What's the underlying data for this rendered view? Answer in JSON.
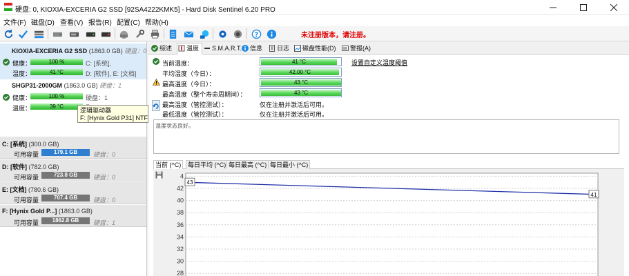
{
  "window": {
    "title": "硬盘: 0, KIOXIA-EXCERIA G2 SSD [92SA4222KMK5] - Hard Disk Sentinel 6.20 PRO"
  },
  "menu": [
    "文件(F)",
    "磁盘(D)",
    "查看(V)",
    "报告(R)",
    "配置(C)",
    "帮助(H)"
  ],
  "toolbar": {
    "unregistered": "未注册版本，请注册。"
  },
  "disks": [
    {
      "name": "KIOXIA-EXCERIA G2 SSD",
      "size": "(1863.0 GB)",
      "disk_label": "硬盘：0",
      "health_label": "健康：",
      "health_value": "100 %",
      "health_percent": 100,
      "temp_label": "温度：",
      "temp_value": "41 °C",
      "partitions_a": "C: [系统],",
      "partitions_b": "D: [软件], E: [文档]"
    },
    {
      "name": "SHGP31-2000GM",
      "size": "(1863.0 GB)",
      "disk_label": "硬盘：1",
      "health_label": "健康：",
      "health_value": "100 %",
      "health_percent": 100,
      "temp_label": "温度：",
      "temp_value": "39 °C",
      "partitions_a": "F:"
    }
  ],
  "tooltip": {
    "line1": "逻辑驱动器",
    "line2": "F: [Hynix Gold P31] NTFS"
  },
  "volumes": [
    {
      "name": "C: [系统]",
      "size": "(300.0 GB)",
      "free_label": "可用容量",
      "free_value": "179.1 GB",
      "disk": "硬盘：0",
      "color": "#2f7fd0"
    },
    {
      "name": "D: [软件]",
      "size": "(782.0 GB)",
      "free_label": "可用容量",
      "free_value": "723.8 GB",
      "disk": "硬盘：0",
      "color": "#767676"
    },
    {
      "name": "E: [文档]",
      "size": "(780.6 GB)",
      "free_label": "可用容量",
      "free_value": "707.4 GB",
      "disk": "硬盘：0",
      "color": "#767676"
    },
    {
      "name": "F: [Hynix Gold P...]",
      "size": "(1863.0 GB)",
      "free_label": "可用容量",
      "free_value": "1862.8 GB",
      "disk": "硬盘：1",
      "color": "#767676"
    }
  ],
  "tabs": [
    "综述",
    "温度",
    "S.M.A.R.T.",
    "信息",
    "日志",
    "磁盘性能(D)",
    "警报(A)"
  ],
  "temperature": {
    "rows": [
      {
        "label": "当前温度：",
        "value": "41 °C",
        "icon": "check-icon"
      },
      {
        "label": "平均温度（今日）：",
        "value": "42.00 °C",
        "icon": "none"
      },
      {
        "label": "最高温度（今日）：",
        "value": "43 °C",
        "icon": "warning-icon"
      },
      {
        "label": "最高温度（整个寿命周期间）：",
        "value": "43 °C",
        "icon": "none"
      }
    ],
    "test_rows": [
      {
        "label": "最高温度（管控测试）：",
        "note": "仅在注册并激活后可用。"
      },
      {
        "label": "最低温度（管控测试）：",
        "note": "仅在注册并激活后可用。"
      }
    ],
    "link": "设置自定义温度阈值",
    "status": "温度状态良好。"
  },
  "subtabs": [
    "当前 (^C)",
    "每日平均 (^C)",
    "每日最高 (^C)",
    "每日最小 (^C)"
  ],
  "chart_data": {
    "type": "line",
    "x": [
      0,
      1
    ],
    "series": [
      {
        "values": [
          43,
          41
        ]
      }
    ],
    "point_labels": [
      "43",
      "41"
    ],
    "y_ticks": [
      "4",
      "42",
      "40",
      "38",
      "36",
      "34",
      "32",
      "30",
      "28"
    ],
    "ylim": [
      27,
      44.5
    ],
    "line_color": "#1f2fa8"
  }
}
